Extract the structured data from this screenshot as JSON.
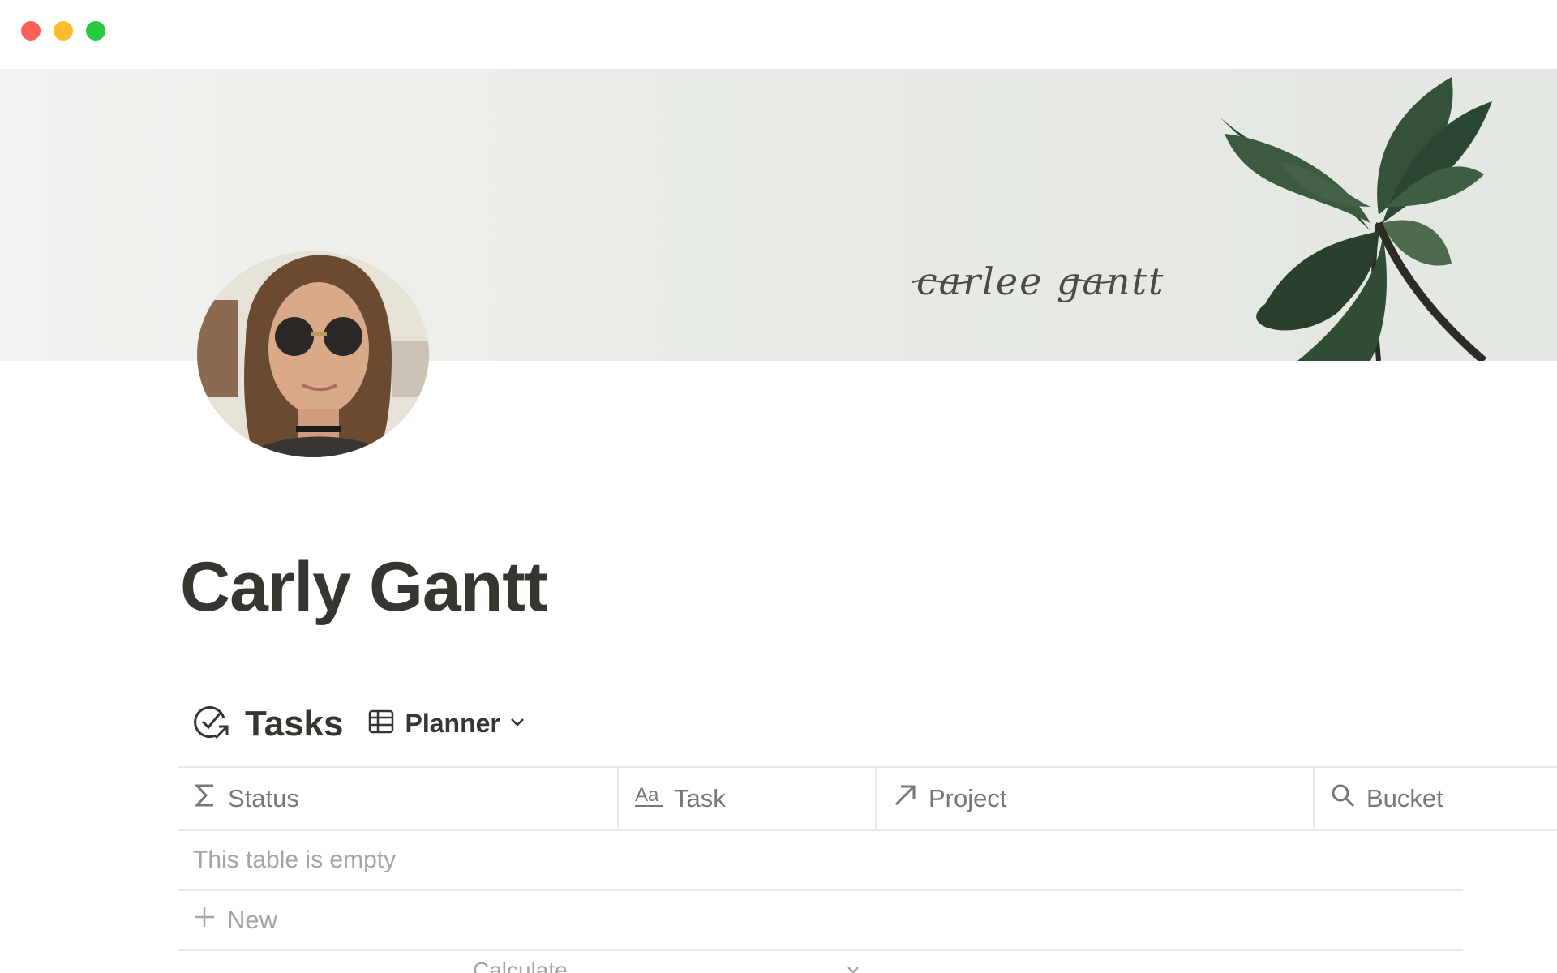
{
  "window": {
    "controls": [
      "close",
      "minimize",
      "maximize"
    ]
  },
  "cover": {
    "signature": "carlee gantt"
  },
  "page": {
    "title": "Carly Gantt"
  },
  "database": {
    "icon": "check-circle-arrow-icon",
    "title": "Tasks",
    "view": {
      "icon": "table-icon",
      "label": "Planner",
      "caret": "chevron-down-icon"
    },
    "columns": [
      {
        "icon": "sigma-icon",
        "label": "Status"
      },
      {
        "icon": "text-aa-icon",
        "label": "Task"
      },
      {
        "icon": "arrow-up-right-icon",
        "label": "Project"
      },
      {
        "icon": "search-icon",
        "label": "Bucket"
      }
    ],
    "empty_message": "This table is empty",
    "new_label": "New",
    "calculate_label": "Calculate"
  },
  "colors": {
    "text_primary": "#37352f",
    "text_muted": "#787774",
    "text_faint": "#a5a4a0",
    "border": "#e9e9e7"
  }
}
